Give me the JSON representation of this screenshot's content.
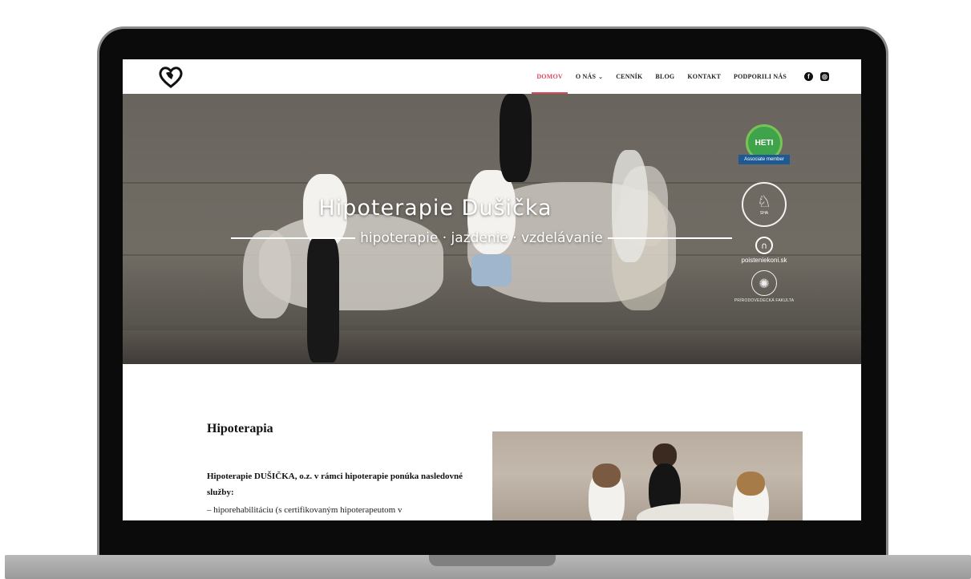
{
  "site": {
    "nav": {
      "items": [
        {
          "label": "DOMOV",
          "active": true
        },
        {
          "label": "O NÁS",
          "dropdown": true
        },
        {
          "label": "CENNÍK"
        },
        {
          "label": "BLOG"
        },
        {
          "label": "KONTAKT"
        },
        {
          "label": "PODPORILI NÁS"
        }
      ],
      "social": {
        "facebook": "f",
        "instagram": "◎"
      },
      "accent_color": "#d8485a"
    },
    "hero": {
      "title": "Hipoterapie Dušička",
      "subtitle": "hipoterapie · jazdenie · vzdelávanie",
      "badges": {
        "heti": {
          "name": "HETI",
          "ribbon": "Associate member"
        },
        "sha": {
          "text": "SHA"
        },
        "poistenie": {
          "text": "poisteniekoni.sk"
        },
        "fakulta": {
          "text": "PRÍRODOVEDECKÁ FAKULTA"
        }
      }
    },
    "section": {
      "title": "Hipoterapia",
      "intro": "Hipoterapie DUŠIČKA, o.z. v rámci hipoterapie ponúka nasledovné služby:",
      "list_first": "– hiporehabilitáciu (s certifikovaným hipoterapeutom v"
    }
  }
}
